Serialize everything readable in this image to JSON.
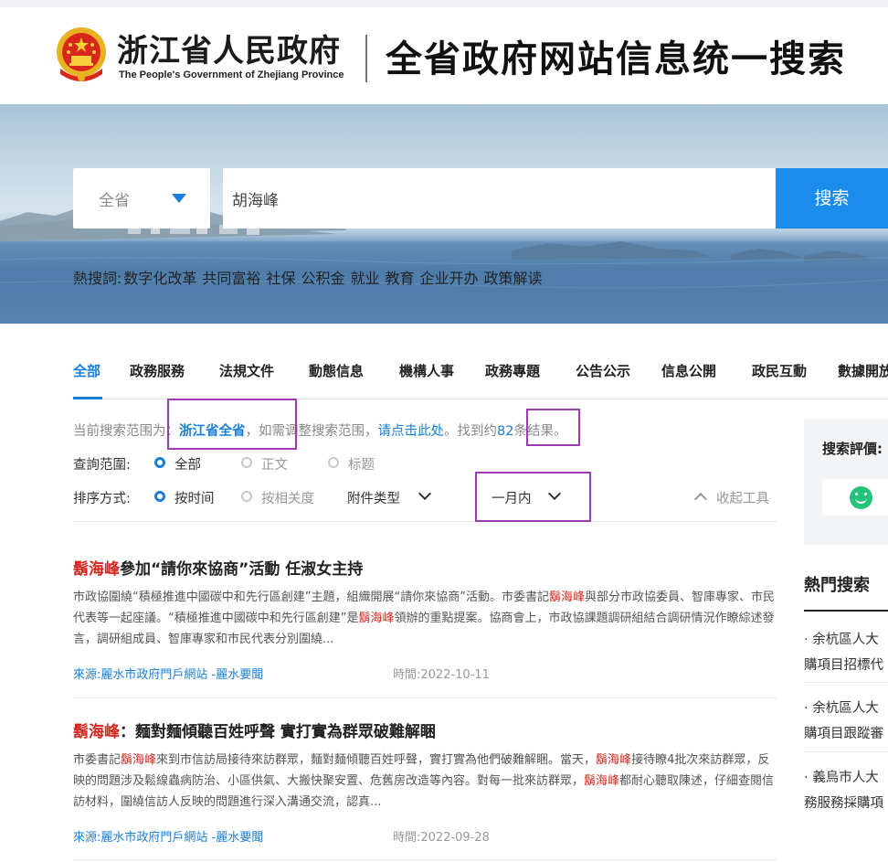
{
  "header": {
    "brand_cn": "浙江省人民政府",
    "brand_en": "The People's Government of Zhejiang Province",
    "title": "全省政府网站信息统一搜索"
  },
  "search": {
    "scope_label": "全省",
    "query": "胡海峰",
    "button_label": "搜索"
  },
  "hot_words": {
    "label": "熱搜詞:",
    "items": [
      "数字化改革",
      "共同富裕",
      "社保",
      "公积金",
      "就业",
      "教育",
      "企业开办",
      "政策解读"
    ]
  },
  "tabs": [
    "全部",
    "政務服務",
    "法規文件",
    "動態信息",
    "機構人事",
    "政務專題",
    "公告公示",
    "信息公開",
    "政民互動",
    "數據開放"
  ],
  "scope_info": {
    "prefix": "当前搜索范围为：",
    "scope": "浙江省全省",
    "middle": "，如需调整搜索范围，",
    "link": "请点击此处",
    "found_prefix": "。找到约",
    "count": "82",
    "found_suffix": "条结果。"
  },
  "filters": {
    "range_label": "查詢范圍:",
    "range_options": [
      "全部",
      "正文",
      "标题"
    ],
    "sort_label": "排序方式:",
    "sort_options": [
      "按时间",
      "按相关度"
    ],
    "attachment_label": "附件类型",
    "time_label": "一月内",
    "collapse_label": "收起工具"
  },
  "results": [
    {
      "title_hl": "鬍海峰",
      "title_rest": "參加“請你來協商”活動 任淑女主持",
      "snippet": [
        {
          "t": "市政協圍繞“積極推進中國碳中和先行區創建”主題，組織開展“請你來協商”活動。市委書記"
        },
        {
          "t": "鬍海峰",
          "hl": true
        },
        {
          "t": "與部分市政協委員、智庫專家、市民代表等一起座議。“積極推進中國碳中和先行區創建”是"
        },
        {
          "t": "鬍海峰",
          "hl": true
        },
        {
          "t": "領辦的重點提案。協商會上，市政協課題調研組結合調研情況作瞭綜述發言，調研組成員、智庫專家和市民代表分別圍繞..."
        }
      ],
      "source": "來源:麗水市政府門戶網站 -麗水要聞",
      "time": "時間:2022-10-11"
    },
    {
      "title_hl": "鬍海峰",
      "title_rest": "：麵對麵傾聽百姓呼聲 實打實為群眾破難解睏",
      "snippet": [
        {
          "t": "市委書記"
        },
        {
          "t": "鬍海峰",
          "hl": true
        },
        {
          "t": "來到市信訪局接待來訪群眾，麵對麵傾聽百姓呼聲，實打實為他們破難解睏。當天，"
        },
        {
          "t": "鬍海峰",
          "hl": true
        },
        {
          "t": "接待瞭4批次來訪群眾，反映的問題涉及鬆線蟲病防治、小區供氣、大搬快聚安置、危舊房改造等內容。對每一批來訪群眾，"
        },
        {
          "t": "鬍海峰",
          "hl": true
        },
        {
          "t": "都耐心聽取陳述，仔細查閱信訪材料，圍繞信訪人反映的問題進行深入溝通交流，認真..."
        }
      ],
      "source": "來源:麗水市政府門戶網站 -麗水要聞",
      "time": "時間:2022-09-28"
    }
  ],
  "side": {
    "rating_label": "搜索評價:",
    "rating_peek": "満",
    "hot_title": "熱門搜索",
    "hot_items": [
      {
        "line1": "· 余杭區人大",
        "line2": "購項目招標代"
      },
      {
        "line1": "· 余杭區人大",
        "line2": "購項目跟蹤審"
      },
      {
        "line1": "· 義烏市人大",
        "line2": "務服務採購項"
      }
    ]
  },
  "colors": {
    "accent": "#1a7fd8",
    "highlight": "#d7261e",
    "search_button": "#1b8bec",
    "annotation": "#9b3bb0"
  }
}
